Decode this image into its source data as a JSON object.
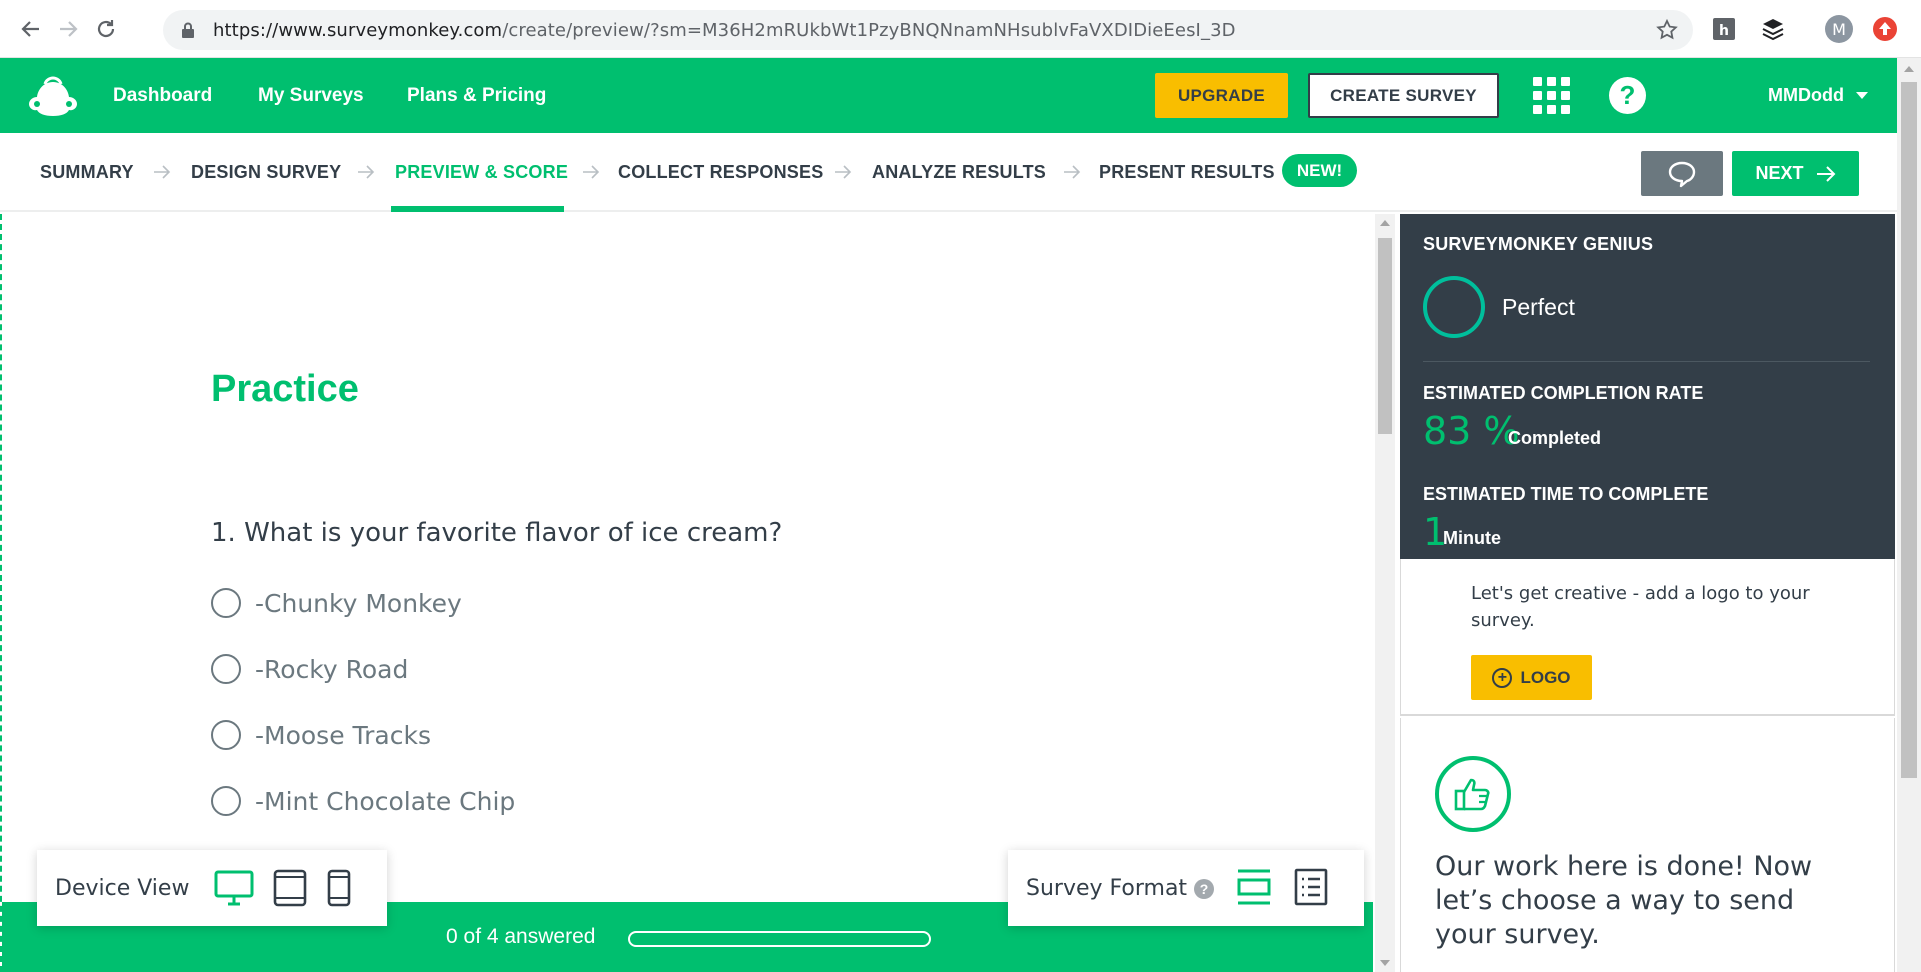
{
  "browser": {
    "url_host": "https://www.surveymonkey.com",
    "url_path": "/create/preview/?sm=M36H2mRUkbWt1PzyBNQNnamNHsublvFaVXDIDieEesI_3D",
    "profile_initial": "M"
  },
  "header": {
    "nav": [
      "Dashboard",
      "My Surveys",
      "Plans & Pricing"
    ],
    "upgrade_label": "UPGRADE",
    "create_label": "CREATE SURVEY",
    "help_label": "?",
    "username": "MMDodd"
  },
  "steps": {
    "items": [
      "SUMMARY",
      "DESIGN SURVEY",
      "PREVIEW & SCORE",
      "COLLECT RESPONSES",
      "ANALYZE RESULTS",
      "PRESENT RESULTS"
    ],
    "active": "PREVIEW & SCORE",
    "new_badge": "NEW!",
    "next_label": "NEXT"
  },
  "survey": {
    "title": "Practice",
    "question": "1. What is your favorite flavor of ice cream?",
    "choices": [
      "-Chunky Monkey",
      "-Rocky Road",
      "-Moose Tracks",
      "-Mint Chocolate Chip"
    ]
  },
  "footer": {
    "device_view_label": "Device View",
    "survey_format_label": "Survey Format",
    "survey_format_help": "?",
    "progress_text": "0 of 4 answered",
    "progress_fraction": 0
  },
  "genius": {
    "heading": "SURVEYMONKEY GENIUS",
    "status": "Perfect",
    "completion_label": "ESTIMATED COMPLETION RATE",
    "completion_value": "83 %",
    "completion_unit": "Completed",
    "time_label": "ESTIMATED TIME TO COMPLETE",
    "time_value": "1",
    "time_unit": "Minute"
  },
  "tips": {
    "logo_tip": "Let's get creative - add a logo to your survey.",
    "logo_button": "LOGO",
    "done_message": "Our work here is done! Now let’s choose a way to send your survey."
  },
  "colors": {
    "brand_green": "#00bf6f",
    "upgrade_yellow": "#f9be00",
    "dark": "#333e48"
  }
}
